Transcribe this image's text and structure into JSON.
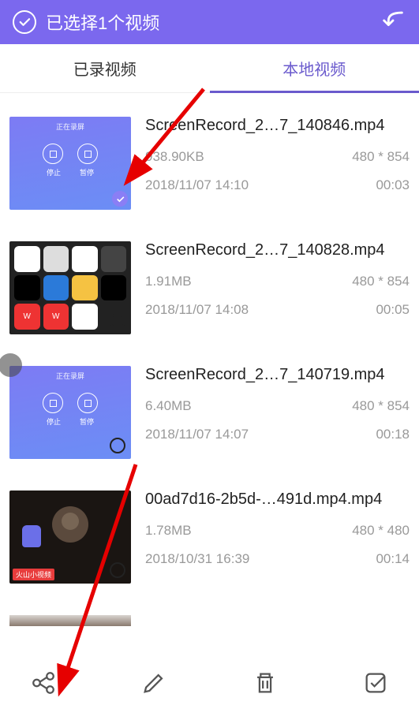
{
  "header": {
    "title": "已选择1个视频"
  },
  "tabs": {
    "recorded": "已录视频",
    "local": "本地视频"
  },
  "videos": [
    {
      "title": "ScreenRecord_2…7_140846.mp4",
      "size": "938.90KB",
      "resolution": "480 * 854",
      "date": "2018/11/07 14:10",
      "duration": "00:03"
    },
    {
      "title": "ScreenRecord_2…7_140828.mp4",
      "size": "1.91MB",
      "resolution": "480 * 854",
      "date": "2018/11/07 14:08",
      "duration": "00:05"
    },
    {
      "title": "ScreenRecord_2…7_140719.mp4",
      "size": "6.40MB",
      "resolution": "480 * 854",
      "date": "2018/11/07 14:07",
      "duration": "00:18"
    },
    {
      "title": "00ad7d16-2b5d-…491d.mp4.mp4",
      "size": "1.78MB",
      "resolution": "480 * 480",
      "date": "2018/10/31 16:39",
      "duration": "00:14"
    }
  ],
  "thumb_labels": {
    "stop": "停止",
    "pause": "暂停",
    "top": "正在录屏"
  },
  "huoshan": "火山小视频"
}
